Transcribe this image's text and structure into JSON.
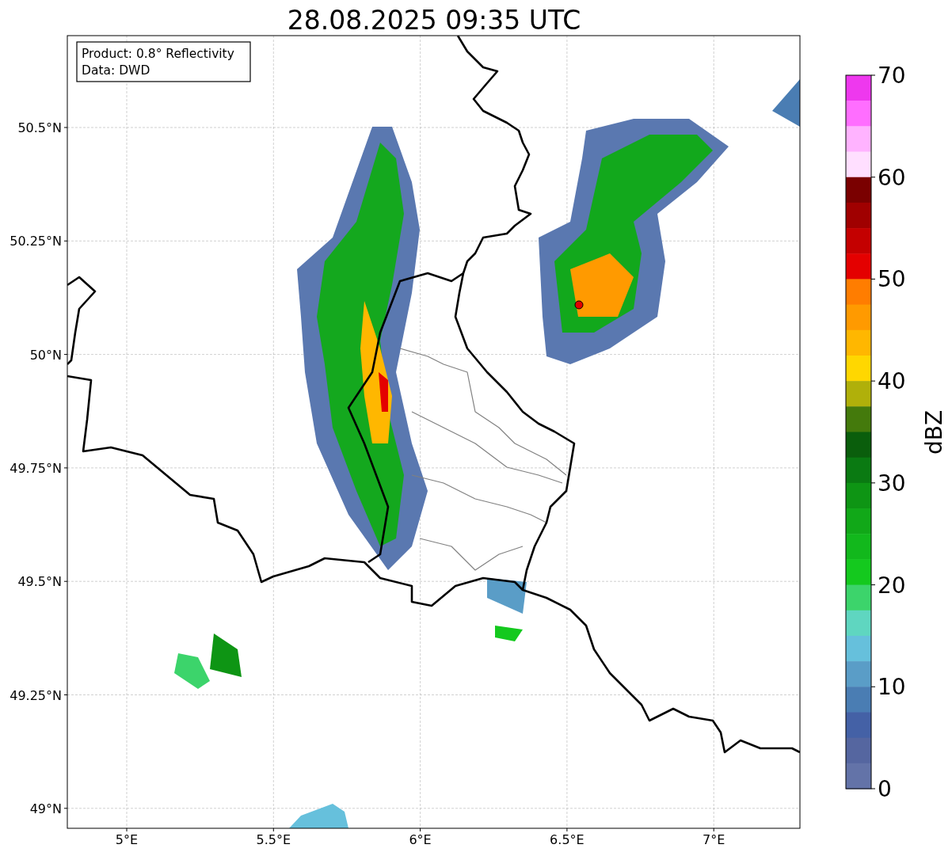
{
  "title": "28.08.2025 09:35 UTC",
  "info": [
    "Product: 0.8° Reflectivity",
    "Data: DWD"
  ],
  "y_ticks": [
    "50.5°N",
    "50.25°N",
    "50°N",
    "49.75°N",
    "49.5°N",
    "49.25°N",
    "49°N"
  ],
  "x_ticks": [
    "5°E",
    "5.5°E",
    "6°E",
    "6.5°E",
    "7°E"
  ],
  "colorbar": {
    "label": "dBZ",
    "ticks": [
      "70",
      "60",
      "50",
      "40",
      "30",
      "20",
      "10",
      "0"
    ],
    "bands": [
      {
        "color": "#ee38ee"
      },
      {
        "color": "#ff6eff"
      },
      {
        "color": "#ffb3ff"
      },
      {
        "color": "#ffdfff"
      },
      {
        "color": "#7a0000"
      },
      {
        "color": "#a00000"
      },
      {
        "color": "#c40000"
      },
      {
        "color": "#e40000"
      },
      {
        "color": "#ff7d00"
      },
      {
        "color": "#ff9a00"
      },
      {
        "color": "#ffb700"
      },
      {
        "color": "#ffd700"
      },
      {
        "color": "#b0b00a"
      },
      {
        "color": "#447a0c"
      },
      {
        "color": "#0a5e0c"
      },
      {
        "color": "#0a7a12"
      },
      {
        "color": "#0e9514"
      },
      {
        "color": "#11a818"
      },
      {
        "color": "#12b81c"
      },
      {
        "color": "#14c91e"
      },
      {
        "color": "#3cd46b"
      },
      {
        "color": "#5fd6c0"
      },
      {
        "color": "#66c0dc"
      },
      {
        "color": "#5a9dc7"
      },
      {
        "color": "#4a7db3"
      },
      {
        "color": "#4461a6"
      },
      {
        "color": "#5566a0"
      },
      {
        "color": "#6373a8"
      }
    ]
  }
}
